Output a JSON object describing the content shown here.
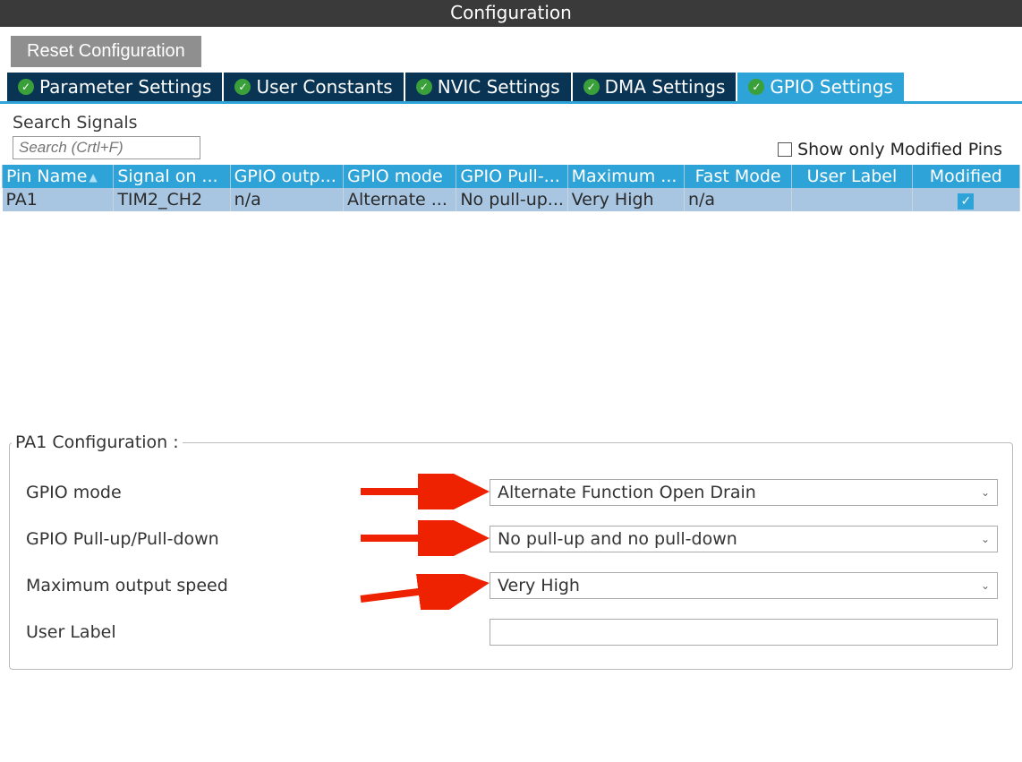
{
  "title": "Configuration",
  "reset_button": "Reset Configuration",
  "tabs": [
    {
      "label": "Parameter Settings"
    },
    {
      "label": "User Constants"
    },
    {
      "label": "NVIC Settings"
    },
    {
      "label": "DMA Settings"
    },
    {
      "label": "GPIO Settings"
    }
  ],
  "search": {
    "label": "Search Signals",
    "placeholder": "Search (Crtl+F)"
  },
  "show_modified_label": "Show only Modified Pins",
  "table": {
    "headers": {
      "pin_name": "Pin Name",
      "signal": "Signal on ...",
      "gpio_out": "GPIO outp...",
      "gpio_mode": "GPIO mode",
      "gpio_pull": "GPIO Pull-...",
      "max": "Maximum ...",
      "fast": "Fast Mode",
      "user_label": "User Label",
      "modified": "Modified"
    },
    "rows": [
      {
        "pin_name": "PA1",
        "signal": "TIM2_CH2",
        "gpio_out": "n/a",
        "gpio_mode": "Alternate ...",
        "gpio_pull": "No pull-up...",
        "max": "Very High",
        "fast": "n/a",
        "user_label": "",
        "modified": true
      }
    ]
  },
  "config_section": {
    "title": "PA1 Configuration :",
    "fields": {
      "gpio_mode": {
        "label": "GPIO mode",
        "value": "Alternate Function Open Drain"
      },
      "gpio_pull": {
        "label": "GPIO Pull-up/Pull-down",
        "value": "No pull-up and no pull-down"
      },
      "max_speed": {
        "label": "Maximum output speed",
        "value": "Very High"
      },
      "user_label": {
        "label": "User Label",
        "value": ""
      }
    }
  }
}
